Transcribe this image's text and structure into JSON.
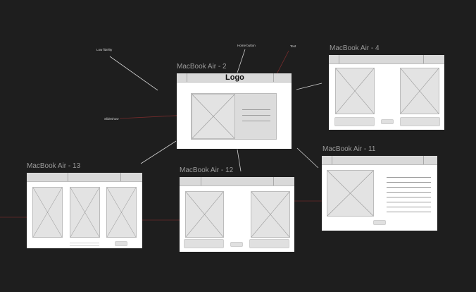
{
  "annotations": {
    "low_fidelity": "Low fidelity",
    "home_button": "Home button",
    "text": "Text",
    "slideshow": "Slideshow"
  },
  "frames": {
    "main": {
      "title": "MacBook Air - 2",
      "logo": "Logo"
    },
    "f4": {
      "title": "MacBook Air - 4"
    },
    "f11": {
      "title": "MacBook Air - 11"
    },
    "f12": {
      "title": "MacBook Air - 12"
    },
    "f13": {
      "title": "MacBook Air - 13"
    }
  },
  "colors": {
    "canvas": "#1e1e1e",
    "frame": "#ffffff",
    "navbar": "#d9d9d9",
    "placeholder": "#e3e3e3",
    "connector": "#d0d0d0",
    "accent_connector": "#8b2a2a"
  }
}
